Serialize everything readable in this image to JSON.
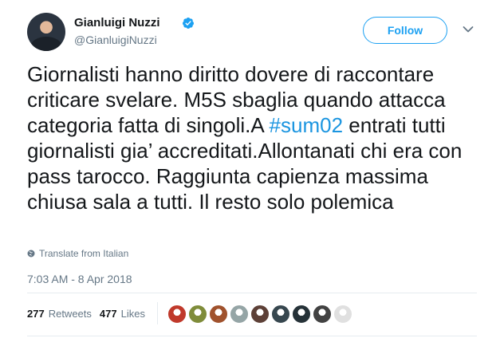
{
  "author": {
    "name": "Gianluigi Nuzzi",
    "handle": "@GianluigiNuzzi",
    "verified": true,
    "avatar_icon": "user-avatar"
  },
  "follow_label": "Follow",
  "menu_icon": "chevron-down-icon",
  "tweet": {
    "text_before": "Giornalisti hanno diritto dovere di raccontare criticare svelare. M5S sbaglia quando attacca categoria fatta di singoli.A ",
    "hashtag": "#sum02",
    "text_after": " entrati tutti giornalisti gia’ accreditati.Allontanati chi era con pass tarocco. Raggiunta capienza massima chiusa sala a tutti. Il resto solo polemica"
  },
  "translate_label": "Translate from Italian",
  "timestamp": "7:03 AM - 8 Apr 2018",
  "stats": {
    "retweets_count": "277",
    "retweets_label": "Retweets",
    "likes_count": "477",
    "likes_label": "Likes"
  },
  "liker_avatar_colors": [
    "#c0392b",
    "#7f8c3a",
    "#a0522d",
    "#95a5a6",
    "#5d4037",
    "#37474f",
    "#263238",
    "#424242",
    "#e0e0e0"
  ],
  "colors": {
    "accent": "#1da1f2",
    "hashtag": "#1b95e0",
    "text": "#14171a",
    "secondary": "#657786"
  }
}
